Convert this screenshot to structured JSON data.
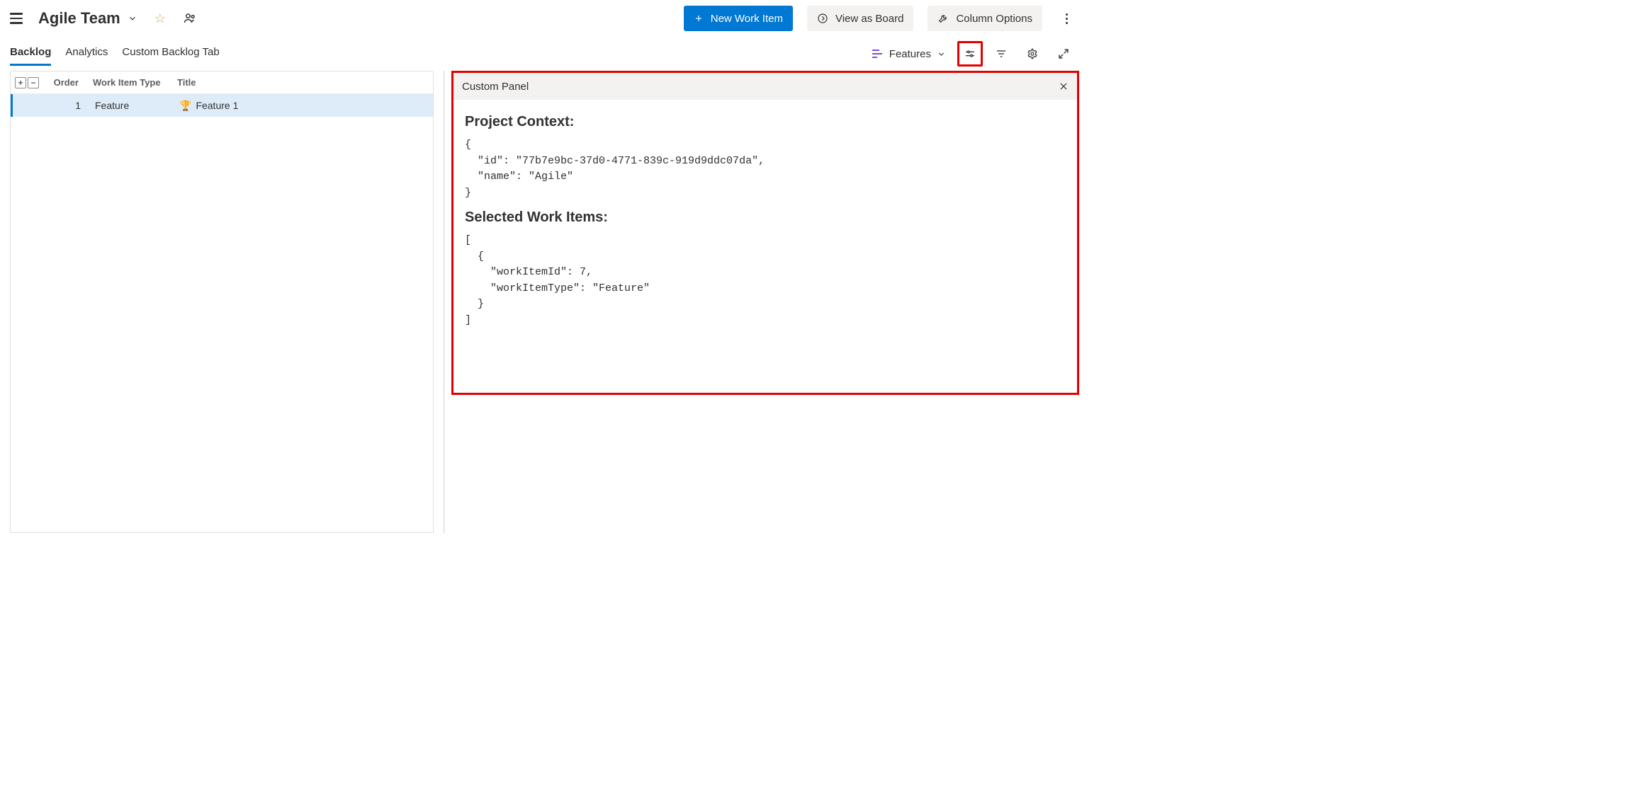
{
  "header": {
    "team_name": "Agile Team",
    "new_work_item": "New Work Item",
    "view_as_board": "View as Board",
    "column_options": "Column Options"
  },
  "tabs": {
    "backlog": "Backlog",
    "analytics": "Analytics",
    "custom": "Custom Backlog Tab"
  },
  "level_selector": {
    "label": "Features"
  },
  "grid": {
    "headers": {
      "order": "Order",
      "type": "Work Item Type",
      "title": "Title"
    },
    "rows": [
      {
        "order": "1",
        "type": "Feature",
        "title": "Feature 1"
      }
    ]
  },
  "panel": {
    "title": "Custom Panel",
    "sections": {
      "project_context_heading": "Project Context:",
      "project_context_json": "{\n  \"id\": \"77b7e9bc-37d0-4771-839c-919d9ddc07da\",\n  \"name\": \"Agile\"\n}",
      "selected_items_heading": "Selected Work Items:",
      "selected_items_json": "[\n  {\n    \"workItemId\": 7,\n    \"workItemType\": \"Feature\"\n  }\n]"
    }
  }
}
